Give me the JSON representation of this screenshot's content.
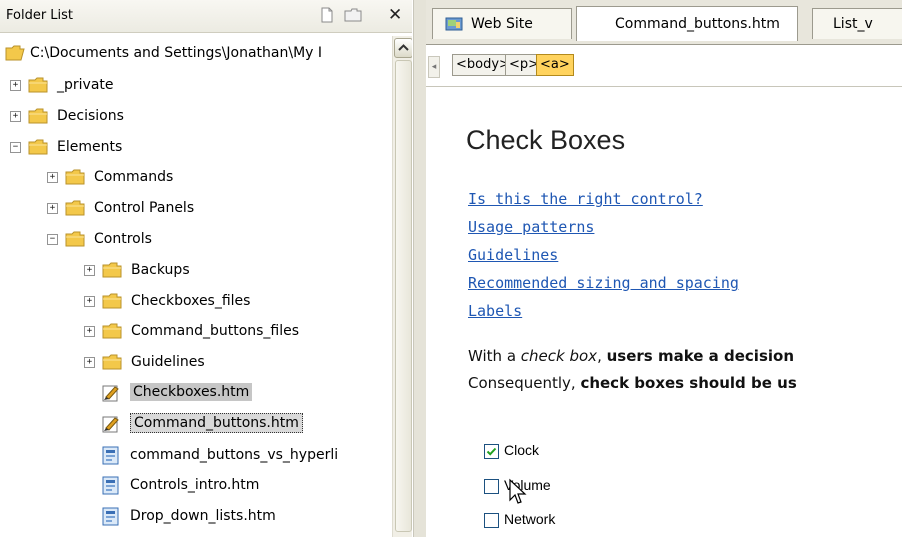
{
  "folder_list": {
    "title": "Folder List",
    "root_path": "C:\\Documents and Settings\\Jonathan\\My I",
    "items": [
      {
        "label": "_private",
        "expander": "+",
        "type": "folder"
      },
      {
        "label": "Decisions",
        "expander": "+",
        "type": "folder"
      },
      {
        "label": "Elements",
        "expander": "−",
        "type": "folder"
      },
      {
        "label": "Commands",
        "expander": "+",
        "type": "folder"
      },
      {
        "label": "Control Panels",
        "expander": "+",
        "type": "folder"
      },
      {
        "label": "Controls",
        "expander": "−",
        "type": "folder"
      },
      {
        "label": "Backups",
        "expander": "+",
        "type": "folder"
      },
      {
        "label": "Checkboxes_files",
        "expander": "+",
        "type": "folder"
      },
      {
        "label": "Command_buttons_files",
        "expander": "+",
        "type": "folder"
      },
      {
        "label": "Guidelines",
        "expander": "+",
        "type": "folder"
      },
      {
        "label": "Checkboxes.htm",
        "type": "edited-page"
      },
      {
        "label": "Command_buttons.htm",
        "type": "edited-page"
      },
      {
        "label": "command_buttons_vs_hyperli",
        "type": "page"
      },
      {
        "label": "Controls_intro.htm",
        "type": "page"
      },
      {
        "label": "Drop_down_lists.htm",
        "type": "page"
      }
    ],
    "close_glyph": "✕"
  },
  "tabs": [
    {
      "label": "Web Site"
    },
    {
      "label": "Command_buttons.htm",
      "active": true
    },
    {
      "label": "List_v"
    }
  ],
  "tag_selector": [
    "<body>",
    "<p>",
    "<a>"
  ],
  "document": {
    "heading": "Check Boxes",
    "links": [
      "Is this the right control?",
      "Usage patterns",
      "Guidelines",
      "Recommended sizing and spacing",
      "Labels"
    ],
    "para1": {
      "t1": "With a ",
      "t2": "check box",
      "t3": ", ",
      "t4": "users make a decision"
    },
    "para2": {
      "t1": "Consequently, ",
      "t2": "check boxes should be us"
    },
    "checkboxes": [
      {
        "label": "Clock",
        "checked": true
      },
      {
        "label": "Volume",
        "checked": false
      },
      {
        "label": "Network",
        "checked": false
      }
    ]
  },
  "colors": {
    "link": "#1f57b3",
    "active_tag": "#ffd35e",
    "folder": "#f3c84a"
  }
}
